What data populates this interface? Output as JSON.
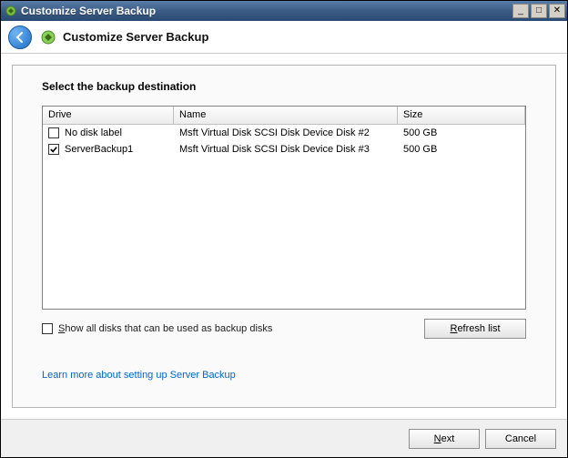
{
  "window": {
    "title": "Customize Server Backup"
  },
  "header": {
    "title": "Customize Server Backup"
  },
  "page": {
    "instruction": "Select the backup destination",
    "columns": {
      "drive": "Drive",
      "name": "Name",
      "size": "Size"
    },
    "rows": [
      {
        "checked": false,
        "drive": "No disk label",
        "name": "Msft Virtual Disk SCSI Disk Device Disk #2",
        "size": "500 GB"
      },
      {
        "checked": true,
        "drive": "ServerBackup1",
        "name": "Msft Virtual Disk SCSI Disk Device Disk #3",
        "size": "500 GB"
      }
    ],
    "show_all_label": "Show all disks that can be used as backup disks",
    "show_all_checked": false,
    "refresh_label": "Refresh list",
    "learn_more": "Learn more about setting up Server Backup"
  },
  "footer": {
    "next": "Next",
    "cancel": "Cancel"
  }
}
